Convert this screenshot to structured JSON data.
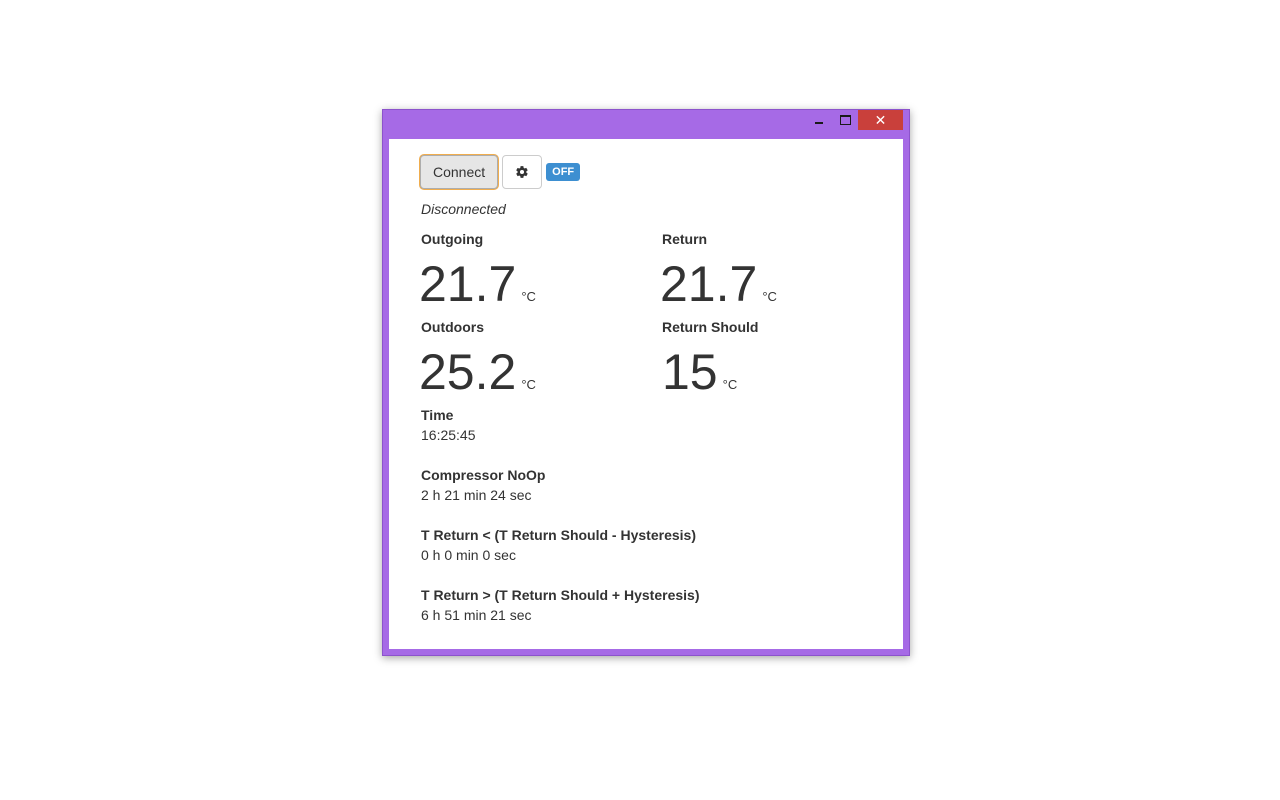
{
  "window": {
    "close_glyph": "✕",
    "accent_color": "#a66ae6",
    "close_color": "#c9403b"
  },
  "toolbar": {
    "connect_label": "Connect",
    "gear_icon": "gear-icon",
    "off_badge": "OFF"
  },
  "status": "Disconnected",
  "readings": {
    "outgoing": {
      "label": "Outgoing",
      "value": "21.7",
      "unit": "°C"
    },
    "return": {
      "label": "Return",
      "value": "21.7",
      "unit": "°C"
    },
    "outdoors": {
      "label": "Outdoors",
      "value": "25.2",
      "unit": "°C"
    },
    "return_should": {
      "label": "Return Should",
      "value": "15",
      "unit": "°C"
    }
  },
  "time": {
    "label": "Time",
    "value": "16:25:45"
  },
  "compressor_noop": {
    "label": "Compressor NoOp",
    "value": "2 h 21 min 24 sec"
  },
  "t_return_less": {
    "label": "T Return < (T Return Should - Hysteresis)",
    "value": "0 h 0 min 0 sec"
  },
  "t_return_greater": {
    "label": "T Return > (T Return Should + Hysteresis)",
    "value": "6 h 51 min 21 sec"
  }
}
